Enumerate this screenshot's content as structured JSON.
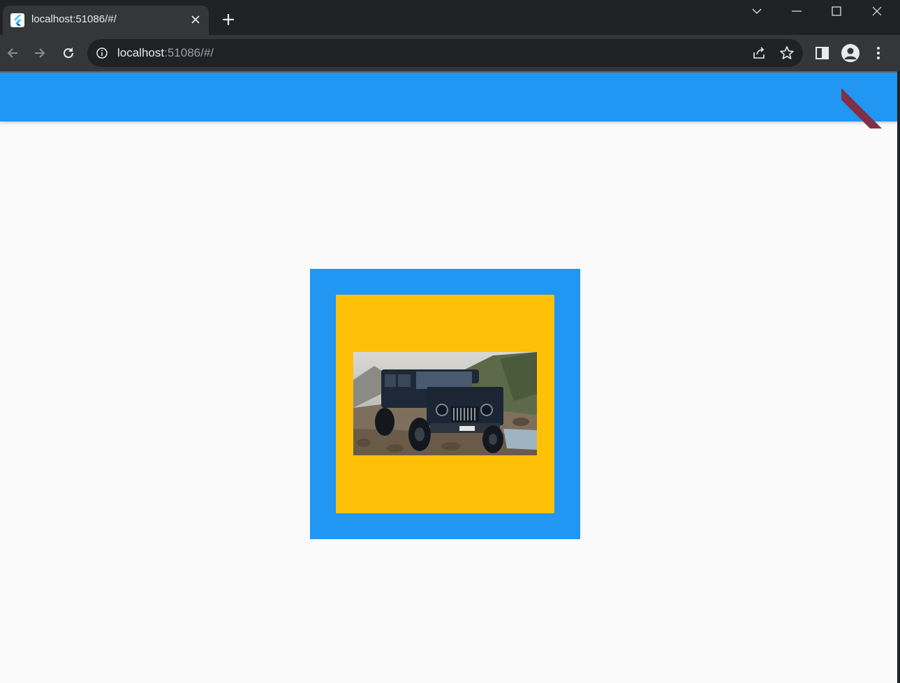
{
  "browser": {
    "tab": {
      "title": "localhost:51086/#/",
      "favicon": "flutter-icon",
      "close_icon": "close-icon"
    },
    "new_tab_icon": "plus-icon",
    "window_controls": [
      "chevron-down-icon",
      "minimize-icon",
      "maximize-icon",
      "close-icon"
    ],
    "toolbar": {
      "back_icon": "arrow-left-icon",
      "forward_icon": "arrow-right-icon",
      "reload_icon": "reload-icon",
      "omnibox": {
        "info_icon": "info-icon",
        "url_host": "localhost",
        "url_rest": ":51086/#/",
        "share_icon": "share-icon",
        "bookmark_icon": "star-icon"
      },
      "side_panel_icon": "side-panel-icon",
      "profile_icon": "person-icon",
      "menu_icon": "kebab-menu-icon"
    },
    "colors": {
      "chrome_dark": "#202124",
      "chrome_toolbar": "#35363a"
    }
  },
  "app": {
    "appbar": {
      "color": "#2196f3",
      "debug_banner_color": "#7f3048"
    },
    "background": "#fafafa",
    "outer_container_color": "#2196f3",
    "inner_container_color": "#ffc107",
    "image": {
      "subject": "suv-photo"
    }
  }
}
